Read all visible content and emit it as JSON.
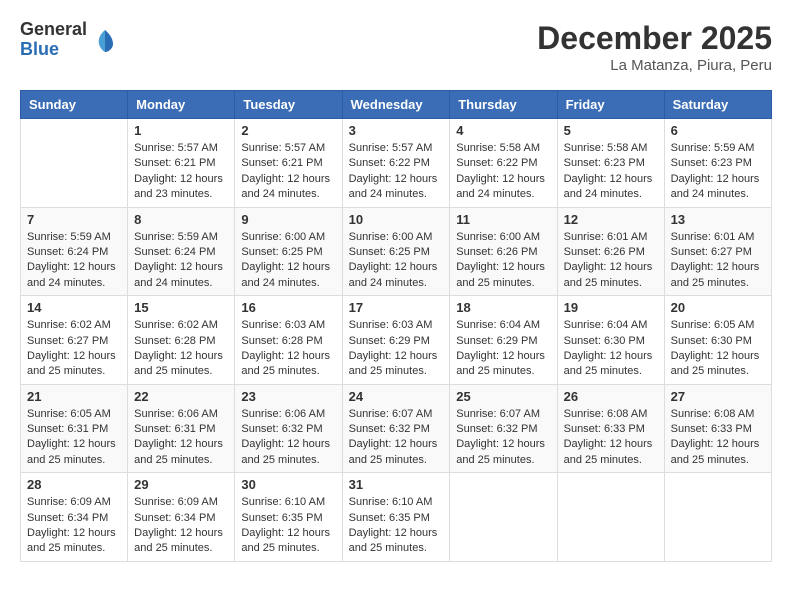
{
  "header": {
    "logo_general": "General",
    "logo_blue": "Blue",
    "month_title": "December 2025",
    "location": "La Matanza, Piura, Peru"
  },
  "calendar": {
    "weekdays": [
      "Sunday",
      "Monday",
      "Tuesday",
      "Wednesday",
      "Thursday",
      "Friday",
      "Saturday"
    ],
    "weeks": [
      [
        {
          "day": "",
          "info": ""
        },
        {
          "day": "1",
          "info": "Sunrise: 5:57 AM\nSunset: 6:21 PM\nDaylight: 12 hours and 23 minutes."
        },
        {
          "day": "2",
          "info": "Sunrise: 5:57 AM\nSunset: 6:21 PM\nDaylight: 12 hours and 24 minutes."
        },
        {
          "day": "3",
          "info": "Sunrise: 5:57 AM\nSunset: 6:22 PM\nDaylight: 12 hours and 24 minutes."
        },
        {
          "day": "4",
          "info": "Sunrise: 5:58 AM\nSunset: 6:22 PM\nDaylight: 12 hours and 24 minutes."
        },
        {
          "day": "5",
          "info": "Sunrise: 5:58 AM\nSunset: 6:23 PM\nDaylight: 12 hours and 24 minutes."
        },
        {
          "day": "6",
          "info": "Sunrise: 5:59 AM\nSunset: 6:23 PM\nDaylight: 12 hours and 24 minutes."
        }
      ],
      [
        {
          "day": "7",
          "info": "Sunrise: 5:59 AM\nSunset: 6:24 PM\nDaylight: 12 hours and 24 minutes."
        },
        {
          "day": "8",
          "info": "Sunrise: 5:59 AM\nSunset: 6:24 PM\nDaylight: 12 hours and 24 minutes."
        },
        {
          "day": "9",
          "info": "Sunrise: 6:00 AM\nSunset: 6:25 PM\nDaylight: 12 hours and 24 minutes."
        },
        {
          "day": "10",
          "info": "Sunrise: 6:00 AM\nSunset: 6:25 PM\nDaylight: 12 hours and 24 minutes."
        },
        {
          "day": "11",
          "info": "Sunrise: 6:00 AM\nSunset: 6:26 PM\nDaylight: 12 hours and 25 minutes."
        },
        {
          "day": "12",
          "info": "Sunrise: 6:01 AM\nSunset: 6:26 PM\nDaylight: 12 hours and 25 minutes."
        },
        {
          "day": "13",
          "info": "Sunrise: 6:01 AM\nSunset: 6:27 PM\nDaylight: 12 hours and 25 minutes."
        }
      ],
      [
        {
          "day": "14",
          "info": "Sunrise: 6:02 AM\nSunset: 6:27 PM\nDaylight: 12 hours and 25 minutes."
        },
        {
          "day": "15",
          "info": "Sunrise: 6:02 AM\nSunset: 6:28 PM\nDaylight: 12 hours and 25 minutes."
        },
        {
          "day": "16",
          "info": "Sunrise: 6:03 AM\nSunset: 6:28 PM\nDaylight: 12 hours and 25 minutes."
        },
        {
          "day": "17",
          "info": "Sunrise: 6:03 AM\nSunset: 6:29 PM\nDaylight: 12 hours and 25 minutes."
        },
        {
          "day": "18",
          "info": "Sunrise: 6:04 AM\nSunset: 6:29 PM\nDaylight: 12 hours and 25 minutes."
        },
        {
          "day": "19",
          "info": "Sunrise: 6:04 AM\nSunset: 6:30 PM\nDaylight: 12 hours and 25 minutes."
        },
        {
          "day": "20",
          "info": "Sunrise: 6:05 AM\nSunset: 6:30 PM\nDaylight: 12 hours and 25 minutes."
        }
      ],
      [
        {
          "day": "21",
          "info": "Sunrise: 6:05 AM\nSunset: 6:31 PM\nDaylight: 12 hours and 25 minutes."
        },
        {
          "day": "22",
          "info": "Sunrise: 6:06 AM\nSunset: 6:31 PM\nDaylight: 12 hours and 25 minutes."
        },
        {
          "day": "23",
          "info": "Sunrise: 6:06 AM\nSunset: 6:32 PM\nDaylight: 12 hours and 25 minutes."
        },
        {
          "day": "24",
          "info": "Sunrise: 6:07 AM\nSunset: 6:32 PM\nDaylight: 12 hours and 25 minutes."
        },
        {
          "day": "25",
          "info": "Sunrise: 6:07 AM\nSunset: 6:32 PM\nDaylight: 12 hours and 25 minutes."
        },
        {
          "day": "26",
          "info": "Sunrise: 6:08 AM\nSunset: 6:33 PM\nDaylight: 12 hours and 25 minutes."
        },
        {
          "day": "27",
          "info": "Sunrise: 6:08 AM\nSunset: 6:33 PM\nDaylight: 12 hours and 25 minutes."
        }
      ],
      [
        {
          "day": "28",
          "info": "Sunrise: 6:09 AM\nSunset: 6:34 PM\nDaylight: 12 hours and 25 minutes."
        },
        {
          "day": "29",
          "info": "Sunrise: 6:09 AM\nSunset: 6:34 PM\nDaylight: 12 hours and 25 minutes."
        },
        {
          "day": "30",
          "info": "Sunrise: 6:10 AM\nSunset: 6:35 PM\nDaylight: 12 hours and 25 minutes."
        },
        {
          "day": "31",
          "info": "Sunrise: 6:10 AM\nSunset: 6:35 PM\nDaylight: 12 hours and 25 minutes."
        },
        {
          "day": "",
          "info": ""
        },
        {
          "day": "",
          "info": ""
        },
        {
          "day": "",
          "info": ""
        }
      ]
    ]
  }
}
